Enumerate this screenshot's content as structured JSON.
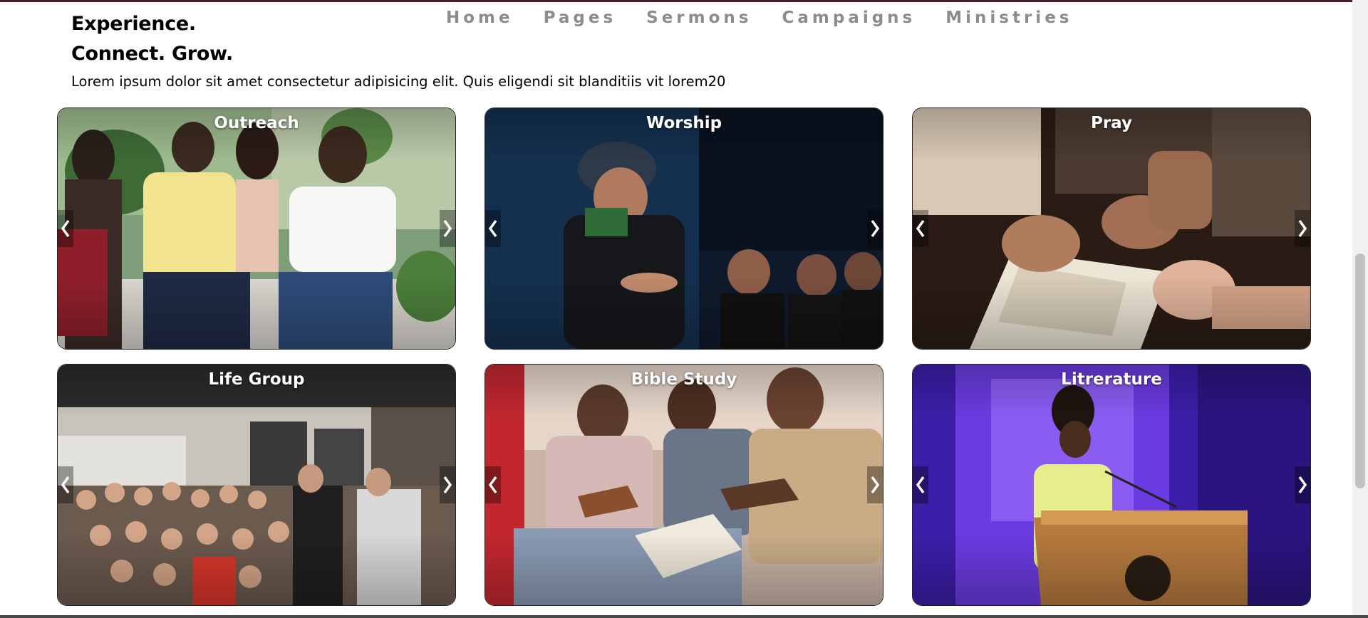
{
  "nav": {
    "items": [
      "Home",
      "Pages",
      "Sermons",
      "Campaigns",
      "Ministries"
    ]
  },
  "hero": {
    "line1": "Experience.",
    "line2": "Connect. Grow.",
    "description": "Lorem ipsum dolor sit amet consectetur adipisicing elit. Quis eligendi sit blanditiis vit lorem20"
  },
  "cards": [
    {
      "title": "Outreach"
    },
    {
      "title": "Worship"
    },
    {
      "title": "Pray"
    },
    {
      "title": "Life Group"
    },
    {
      "title": "Bible Study"
    },
    {
      "title": "Litrerature"
    }
  ],
  "carousel": {
    "prev_icon": "chevron-left-icon",
    "next_icon": "chevron-right-icon"
  }
}
